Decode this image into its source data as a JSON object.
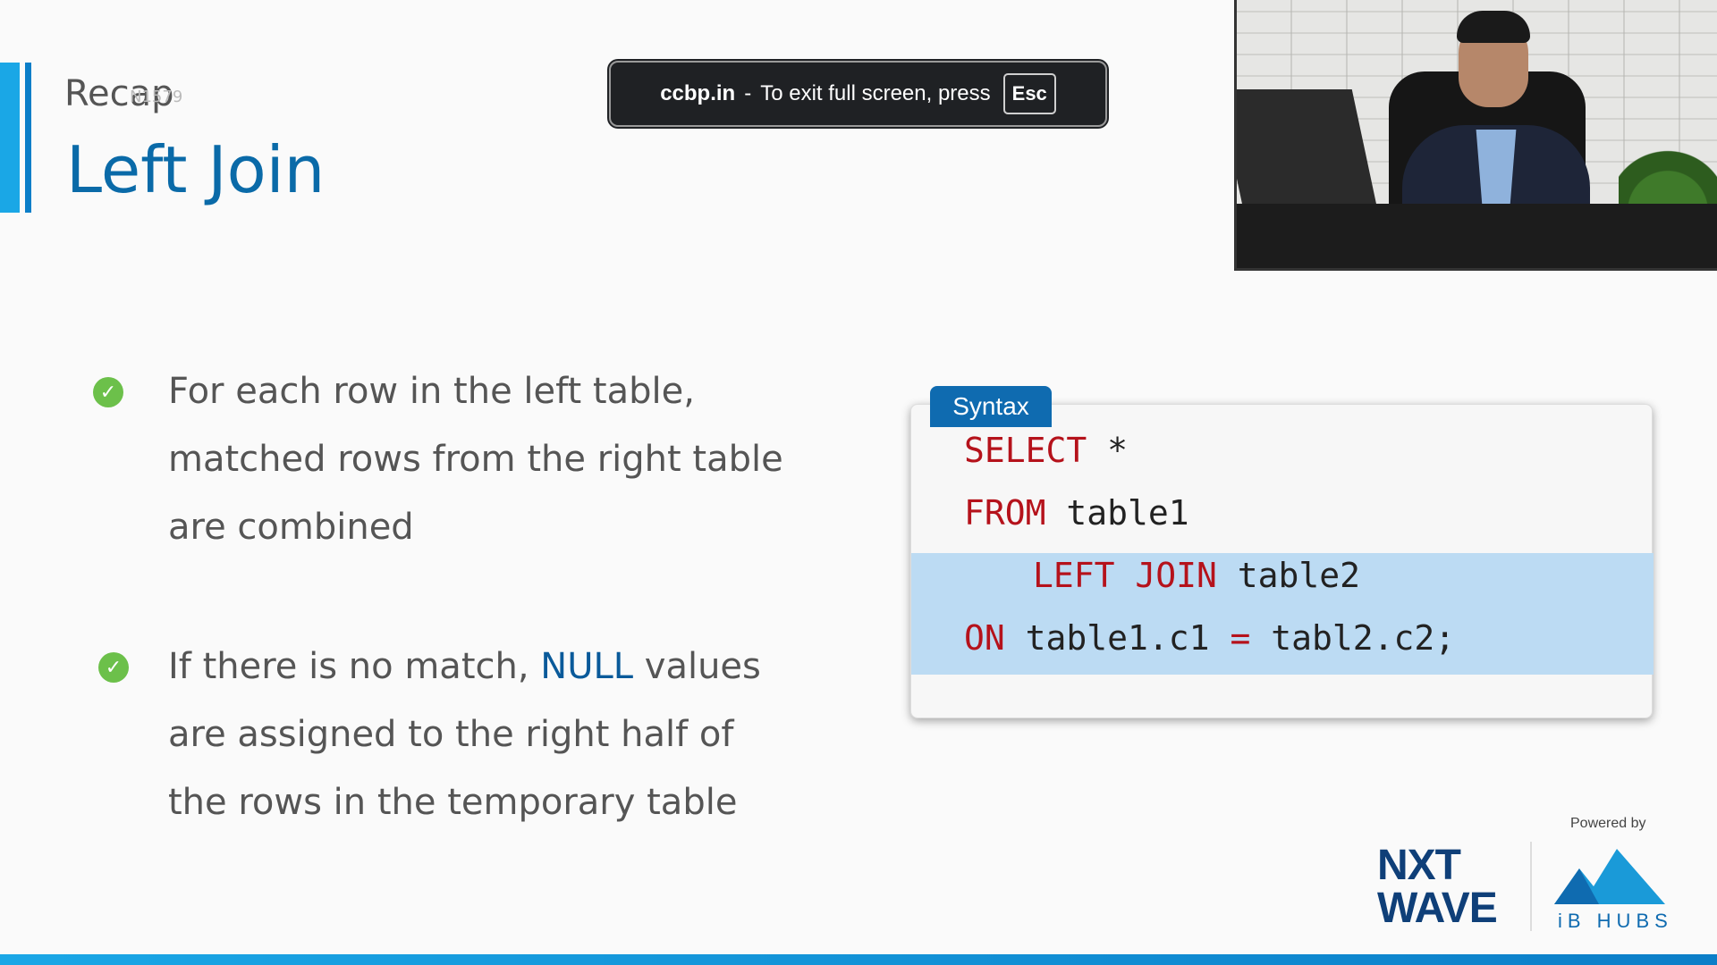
{
  "slide": {
    "section": "Recap",
    "watermark": "N1579",
    "title": "Left Join"
  },
  "toast": {
    "domain": "ccbp.in",
    "separator": "-",
    "message": "To exit full screen, press",
    "key": "Esc"
  },
  "bullets": [
    {
      "lines": [
        "For each row in the left table,",
        "matched rows from the right table",
        "are combined"
      ]
    },
    {
      "before": "If there is no match, ",
      "keyword": "NULL",
      "after": " values",
      "lines": [
        "are assigned to the right half of",
        "the rows in the temporary table"
      ]
    }
  ],
  "syntax": {
    "tab_label": "Syntax",
    "lines": [
      {
        "kw": "SELECT",
        "rest": " *"
      },
      {
        "kw": "FROM",
        "rest": " table1"
      },
      {
        "kw": "LEFT JOIN",
        "rest": " table2"
      },
      {
        "kw": "ON",
        "rest1": " table1.c1 ",
        "op": "=",
        "rest2": " tabl2.c2;"
      }
    ],
    "colors": {
      "keyword": "#b5121b",
      "highlight": "#bcdbf3",
      "tab": "#0f6bb0"
    }
  },
  "footer": {
    "powered_by": "Powered by",
    "logo_line1": "NXT",
    "logo_line2": "WAVE",
    "ib_hubs": "iB HUBS"
  },
  "colors": {
    "accent": "#1aa7e6",
    "title": "#0a6aa8",
    "check": "#6cc04a"
  }
}
